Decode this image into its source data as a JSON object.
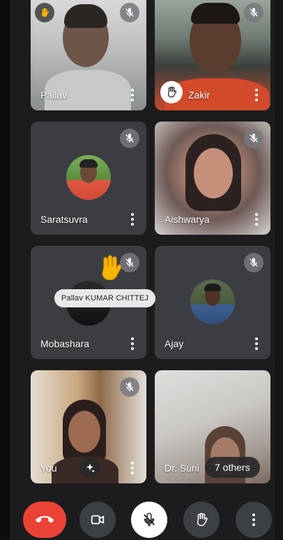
{
  "participants": [
    {
      "name": "Pallav",
      "muted": true,
      "raised_hand": true
    },
    {
      "name": "Zakir",
      "muted": true,
      "raised_hand": true
    },
    {
      "name": "Saratsuvra",
      "muted": true
    },
    {
      "name": "Aishwarya",
      "muted": true
    },
    {
      "name": "Mobashara",
      "muted": true
    },
    {
      "name": "Ajay",
      "muted": true
    },
    {
      "name": "You",
      "muted": true
    },
    {
      "name": "Dr. Suni"
    }
  ],
  "reaction_tooltip": "Pallav KUMAR CHITTEJ",
  "overflow_label": "7 others",
  "icons": {
    "mute": "mic-off-icon",
    "more": "more-vert-icon",
    "hand": "raise-hand-icon",
    "wave": "waving-hand-emoji",
    "effects": "sparkle-icon",
    "end": "call-end-icon",
    "camera": "video-camera-icon",
    "mic": "mic-off-icon"
  },
  "colors": {
    "end_call": "#ea4335",
    "tile_bg": "#3b3d41",
    "control_bg": "#3c3f43"
  }
}
